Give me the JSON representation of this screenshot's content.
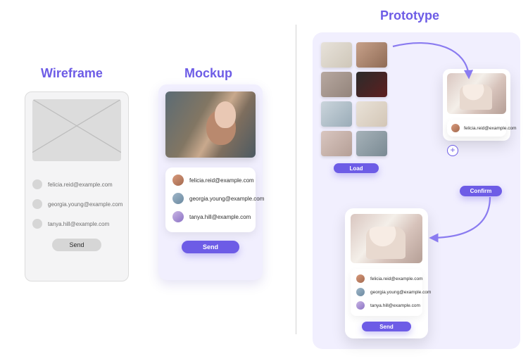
{
  "headings": {
    "wireframe": "Wireframe",
    "mockup": "Mockup",
    "prototype": "Prototype"
  },
  "emails": [
    "felicia.reid@example.com",
    "georgia.young@example.com",
    "tanya.hill@example.com"
  ],
  "buttons": {
    "send": "Send",
    "load": "Load",
    "confirm": "Confirm"
  },
  "avatars": [
    {
      "bg": "linear-gradient(140deg,#d89a7c,#a46a4f)"
    },
    {
      "bg": "linear-gradient(140deg,#a0b7c9,#6b89a0)"
    },
    {
      "bg": "linear-gradient(140deg,#c9b6e4,#8b72c4)"
    }
  ],
  "gallery_thumbs": [
    "linear-gradient(135deg,#e7e2da,#cfc7b9)",
    "linear-gradient(135deg,#c7a18a,#8f6b55)",
    "linear-gradient(135deg,#b7a8a0,#93847b)",
    "linear-gradient(135deg,#2b2b2b,#5e1f1f)",
    "linear-gradient(135deg,#cbd5dc,#9aacb8)",
    "linear-gradient(135deg,#e9e2d8,#d3c6b6)",
    "linear-gradient(135deg,#d9c6c0,#b59f96)",
    "linear-gradient(135deg,#a6b2b9,#7a8a93)"
  ],
  "colors": {
    "accent": "#6d5ce6"
  }
}
